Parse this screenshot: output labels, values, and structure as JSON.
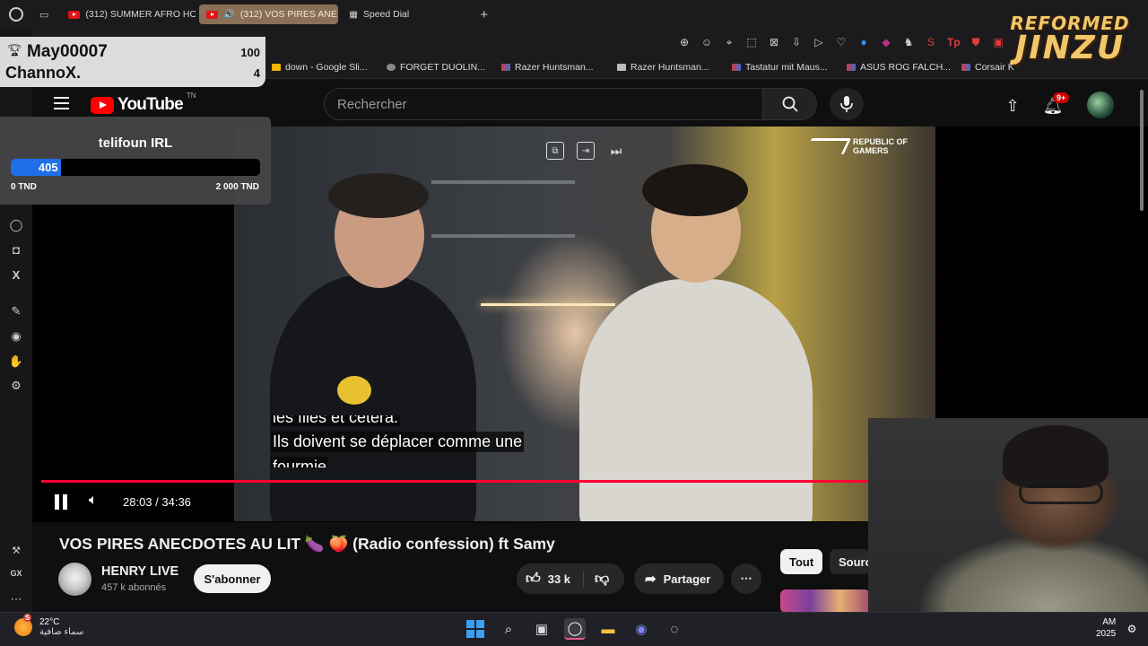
{
  "browser": {
    "tabs": [
      {
        "label": "(312) SUMMER AFRO HO",
        "active": false
      },
      {
        "label": "(312) VOS PIRES ANE",
        "active": true
      },
      {
        "label": "Speed Dial",
        "active": false
      }
    ],
    "new_tab": "+",
    "bookmarks": [
      {
        "label": "down - Google Sli...",
        "color": "#f4b400"
      },
      {
        "label": "FORGET DUOLIN...",
        "color": "#888888"
      },
      {
        "label": "Razer Huntsman...",
        "color": "#d33b3b"
      },
      {
        "label": "Razer Huntsman...",
        "color": "#bbbbbb"
      },
      {
        "label": "Tastatur mit Maus...",
        "color": "#d33b3b"
      },
      {
        "label": "ASUS ROG FALCH...",
        "color": "#d33b3b"
      },
      {
        "label": "Corsair K",
        "color": "#d33b3b"
      }
    ]
  },
  "overlay": {
    "leaderboard": [
      {
        "name": "May00007",
        "value": "100"
      },
      {
        "name": "ChannoX.",
        "value": "4"
      }
    ],
    "goal": {
      "title": "telifoun IRL",
      "current": "405",
      "min_label": "0 TND",
      "max_label": "2 000 TND",
      "fill_fraction": 0.2
    },
    "brand_top": "REFORMED",
    "brand_bottom": "JINZU"
  },
  "youtube": {
    "logo_text": "YouTube",
    "country": "TN",
    "search_placeholder": "Rechercher",
    "notifications": "9+",
    "video": {
      "subtitle_top": "les files et cetera.",
      "subtitle_mid": "Ils doivent se déplacer comme une",
      "subtitle_bot": "fourmie",
      "sponsor": "REPUBLIC OF GAMERS",
      "time": "28:03 / 34:36",
      "progress_fraction": 0.81
    },
    "title": "VOS PIRES ANECDOTES AU LIT 🍆 🍑 (Radio confession) ft Samy",
    "channel": {
      "name": "HENRY LIVE",
      "subs": "457 k abonnés",
      "subscribe": "S'abonner"
    },
    "actions": {
      "likes": "33 k",
      "share": "Partager"
    },
    "chips": [
      "Tout",
      "Sourc"
    ]
  },
  "taskbar": {
    "temp": "22°C",
    "weather": "سماء صافية",
    "weather_badge": "S",
    "clock_top": "AM",
    "clock_bottom": "2025"
  }
}
